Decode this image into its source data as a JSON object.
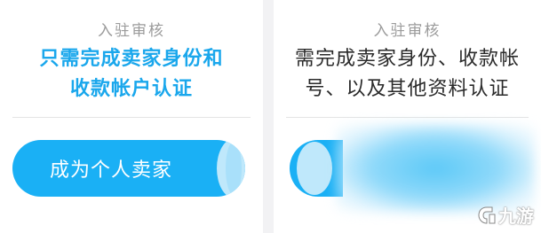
{
  "left_panel": {
    "title": "入驻审核",
    "desc_line1": "只需完成卖家身份和",
    "desc_line2": "收款帐户认证",
    "button_label": "成为个人卖家"
  },
  "right_panel": {
    "title": "入驻审核",
    "desc_line1": "需完成卖家身份、收款帐",
    "desc_line2": "号、以及其他资料认证"
  },
  "watermark": {
    "text": "九游"
  },
  "colors": {
    "accent": "#1ab0f5",
    "accent_text": "#1aa7ec",
    "muted": "#9b9b9b"
  }
}
